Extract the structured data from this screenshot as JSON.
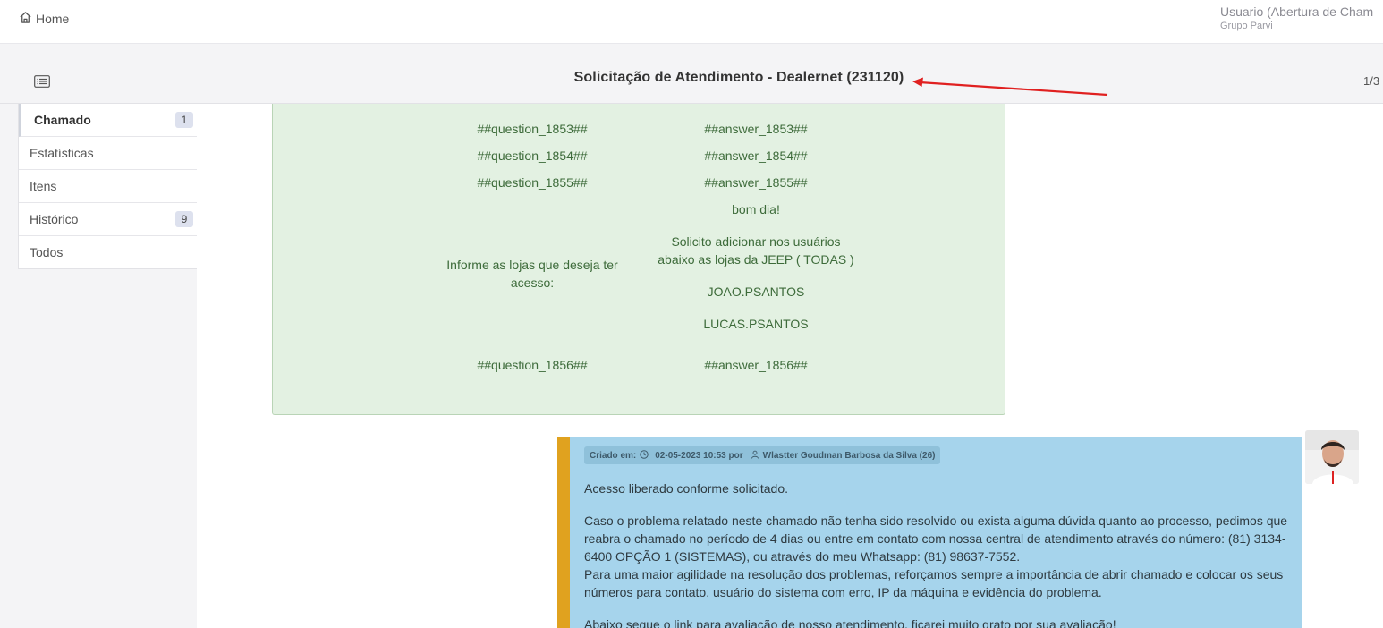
{
  "topbar": {
    "home_label": "Home",
    "user_name": "Usuario (Abertura de Cham",
    "user_org": "Grupo Parvi"
  },
  "header": {
    "title": "Solicitação de Atendimento - Dealernet (231120)",
    "pager": "1/3"
  },
  "sidebar": {
    "items": [
      {
        "label": "Chamado",
        "badge": "1"
      },
      {
        "label": "Estatísticas",
        "badge": ""
      },
      {
        "label": "Itens",
        "badge": ""
      },
      {
        "label": "Histórico",
        "badge": "9"
      },
      {
        "label": "Todos",
        "badge": ""
      }
    ]
  },
  "form": {
    "rows": [
      {
        "question": "##question_1853##",
        "answer": "##answer_1853##"
      },
      {
        "question": "##question_1854##",
        "answer": "##answer_1854##"
      },
      {
        "question": "##question_1855##",
        "answer": "##answer_1855##"
      },
      {
        "question": "##question_1856##",
        "answer": "##answer_1856##"
      }
    ],
    "lojas_question": "Informe as lojas que deseja ter acesso:",
    "lojas_answer": {
      "greeting": "bom dia!",
      "request": "Solicito adicionar nos usuários abaixo as lojas da JEEP ( TODAS )",
      "user1": "JOAO.PSANTOS",
      "user2": "LUCAS.PSANTOS"
    }
  },
  "followup": {
    "meta_prefix": "Criado em:",
    "meta_date": "02-05-2023 10:53 por",
    "meta_author": "Wlastter Goudman Barbosa da Silva (26)",
    "p1": "Acesso liberado conforme solicitado.",
    "p2a": "Caso o problema relatado neste chamado não tenha sido resolvido ou exista alguma dúvida quanto ao processo, pedimos que reabra o chamado no período de 4 dias ou entre em contato com nossa central de atendimento através do número: (81) 3134-6400 OPÇÃO 1 (SISTEMAS), ou através do meu Whatsapp: (81) 98637-7552.",
    "p2b": "Para uma maior agilidade na resolução dos problemas, reforçamos sempre a importância de abrir chamado e colocar os seus números para contato, usuário do sistema com erro, IP da máquina e evidência do problema.",
    "p3": "Abaixo segue o link para avaliação de nosso atendimento, ficarei muito grato por sua avaliação!"
  },
  "colors": {
    "green_bg": "#e3f1e2",
    "blue_bg": "#a6d4ec",
    "accent_orange": "#e0a21f",
    "arrow_red": "#e02020"
  }
}
